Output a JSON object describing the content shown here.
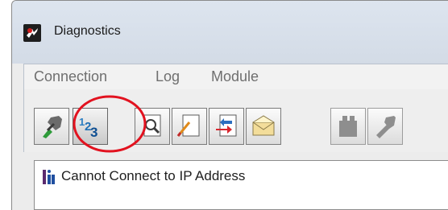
{
  "window": {
    "title": "Diagnostics"
  },
  "menu": {
    "items": [
      "Connection",
      "Log",
      "Module"
    ]
  },
  "toolbar": {
    "buttons": [
      {
        "icon": "disconnect-icon",
        "enabled": true
      },
      {
        "icon": "ip-address-icon",
        "enabled": true,
        "highlighted": true
      },
      {
        "icon": "find-icon",
        "enabled": true
      },
      {
        "icon": "edit-document-icon",
        "enabled": true
      },
      {
        "icon": "import-icon",
        "enabled": true
      },
      {
        "icon": "envelope-icon",
        "enabled": true
      },
      {
        "icon": "module-icon",
        "enabled": false
      },
      {
        "icon": "wrench-icon",
        "enabled": false
      }
    ]
  },
  "status": {
    "message": "Cannot Connect to IP Address"
  },
  "colors": {
    "annotation": "#e2121f",
    "accent_blue": "#1f6fb5",
    "disabled_gray": "#8e8e8e"
  }
}
